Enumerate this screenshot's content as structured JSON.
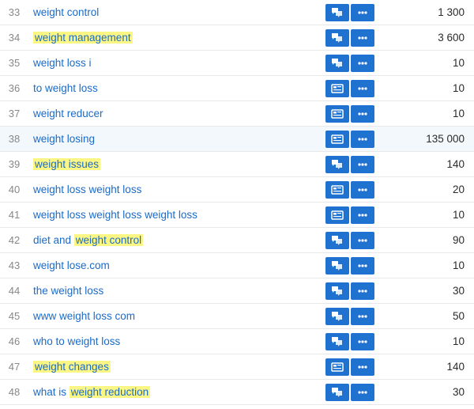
{
  "rows": [
    {
      "num": "33",
      "kw": "weight control",
      "hl": "",
      "hl_start": -1,
      "icon": "chat",
      "vol": "1 300",
      "hover": false
    },
    {
      "num": "34",
      "kw": "weight management",
      "hl": "weight management",
      "hl_start": 0,
      "icon": "chat",
      "vol": "3 600",
      "hover": false
    },
    {
      "num": "35",
      "kw": "weight loss i",
      "hl": "",
      "hl_start": -1,
      "icon": "chat",
      "vol": "10",
      "hover": false
    },
    {
      "num": "36",
      "kw": "to weight loss",
      "hl": "",
      "hl_start": -1,
      "icon": "ad",
      "vol": "10",
      "hover": false
    },
    {
      "num": "37",
      "kw": "weight reducer",
      "hl": "",
      "hl_start": -1,
      "icon": "ad",
      "vol": "10",
      "hover": false
    },
    {
      "num": "38",
      "kw": "weight losing",
      "hl": "",
      "hl_start": -1,
      "icon": "ad",
      "vol": "135 000",
      "hover": true
    },
    {
      "num": "39",
      "kw": "weight issues",
      "hl": "weight issues",
      "hl_start": 0,
      "icon": "chat",
      "vol": "140",
      "hover": false
    },
    {
      "num": "40",
      "kw": "weight loss weight loss",
      "hl": "",
      "hl_start": -1,
      "icon": "ad",
      "vol": "20",
      "hover": false
    },
    {
      "num": "41",
      "kw": "weight loss weight loss weight loss",
      "hl": "",
      "hl_start": -1,
      "icon": "ad",
      "vol": "10",
      "hover": false
    },
    {
      "num": "42",
      "kw": "diet and weight control",
      "hl": "weight control",
      "hl_start": 9,
      "icon": "chat",
      "vol": "90",
      "hover": false
    },
    {
      "num": "43",
      "kw": "weight lose.com",
      "hl": "",
      "hl_start": -1,
      "icon": "chat",
      "vol": "10",
      "hover": false
    },
    {
      "num": "44",
      "kw": "the weight loss",
      "hl": "",
      "hl_start": -1,
      "icon": "chat",
      "vol": "30",
      "hover": false
    },
    {
      "num": "45",
      "kw": "www weight loss com",
      "hl": "",
      "hl_start": -1,
      "icon": "chat",
      "vol": "50",
      "hover": false
    },
    {
      "num": "46",
      "kw": "who to weight loss",
      "hl": "",
      "hl_start": -1,
      "icon": "chat",
      "vol": "10",
      "hover": false
    },
    {
      "num": "47",
      "kw": "weight changes",
      "hl": "weight changes",
      "hl_start": 0,
      "icon": "ad",
      "vol": "140",
      "hover": false
    },
    {
      "num": "48",
      "kw": "what is weight reduction",
      "hl": "weight reduction",
      "hl_start": 8,
      "icon": "chat",
      "vol": "30",
      "hover": false
    }
  ]
}
